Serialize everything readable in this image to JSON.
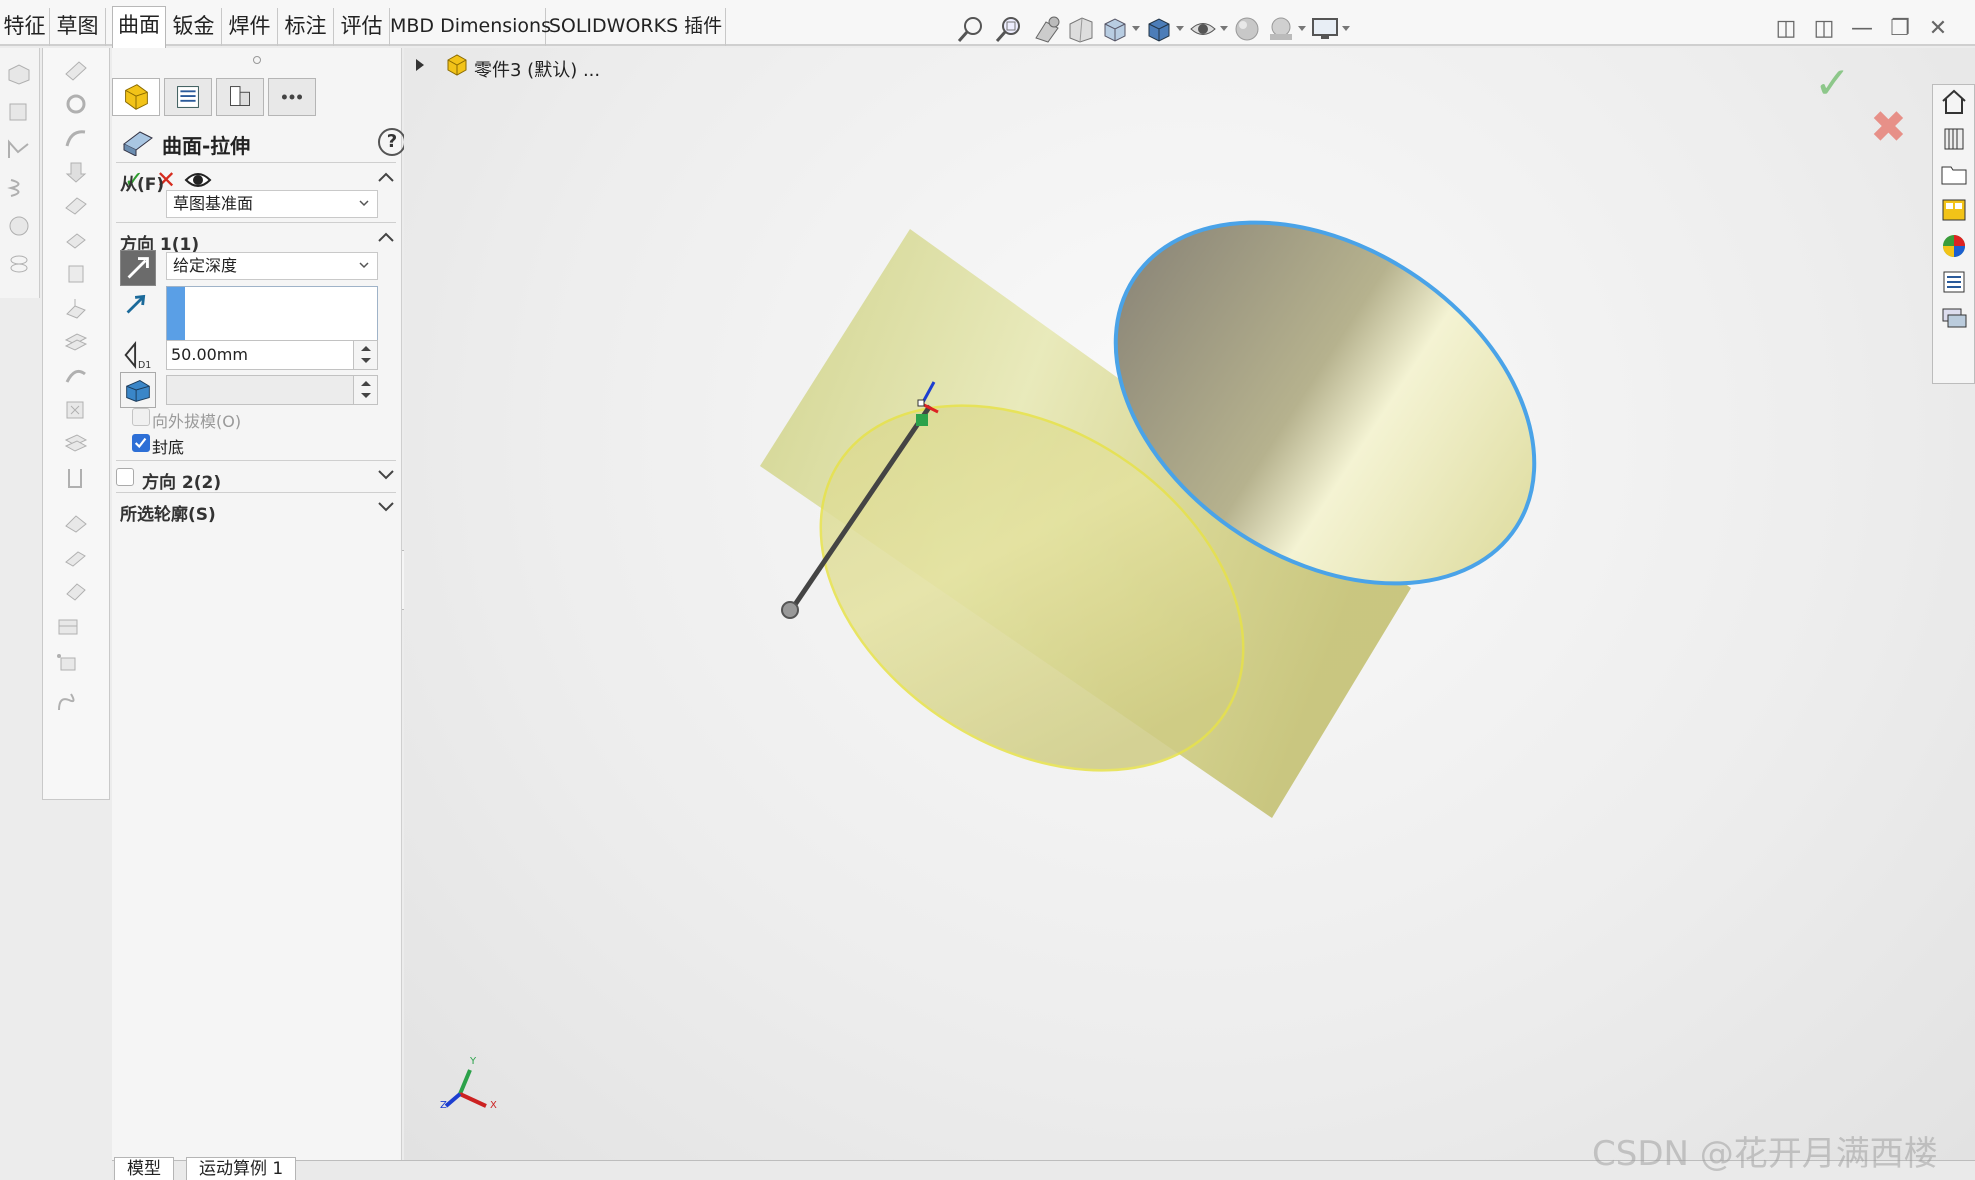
{
  "tabs": [
    {
      "label": "特征",
      "active": false
    },
    {
      "label": "草图",
      "active": false
    },
    {
      "label": "曲面",
      "active": true
    },
    {
      "label": "钣金",
      "active": false
    },
    {
      "label": "焊件",
      "active": false
    },
    {
      "label": "标注",
      "active": false
    },
    {
      "label": "评估",
      "active": false
    },
    {
      "label": "MBD Dimensions",
      "active": false
    },
    {
      "label": "SOLIDWORKS 插件",
      "active": false
    }
  ],
  "view_tools": [
    "zoom-to-fit-icon",
    "zoom-to-area-icon",
    "previous-view-icon",
    "section-view-icon",
    "view-orientation-icon",
    "display-style-icon",
    "hide-show-icon",
    "edit-appearance-icon",
    "apply-scene-icon",
    "view-settings-icon"
  ],
  "property_manager": {
    "title": "曲面-拉伸",
    "help": "?",
    "from_section": {
      "label": "从(F)",
      "value": "草图基准面"
    },
    "direction1": {
      "label": "方向 1(1)",
      "end_condition": "给定深度",
      "depth": "50.00mm",
      "draft_outward_label": "向外拔模(O)",
      "draft_outward_checked": false,
      "cap_end_label": "封底",
      "cap_end_checked": true
    },
    "direction2": {
      "label": "方向 2(2)",
      "checked": false
    },
    "selected_contours": {
      "label": "所选轮廓(S)"
    }
  },
  "feature_tree": {
    "part_name": "零件3 (默认) ..."
  },
  "axes": {
    "x": "X",
    "y": "Y",
    "z": "Z"
  },
  "bottom_tabs": [
    "模型",
    "运动算例 1"
  ],
  "watermark": "CSDN @花开月满西楼",
  "colors": {
    "accent_blue": "#2d6fd6",
    "surface_yellow": "#e6e49a",
    "edge_blue": "#4aa3e8",
    "ok_green": "#2e9b2e",
    "cancel_red": "#d62c1f"
  }
}
